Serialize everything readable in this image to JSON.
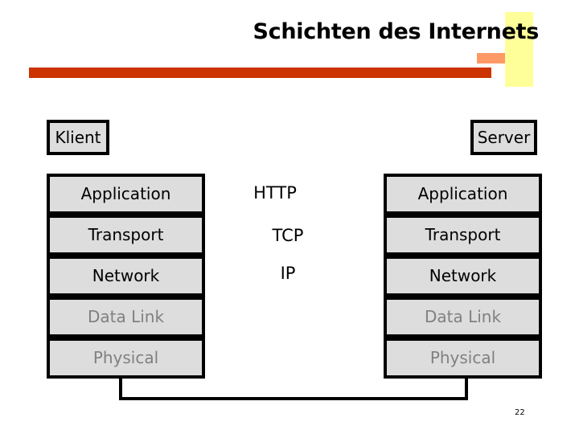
{
  "title": "Schichten des Internets",
  "client_label": "Klient",
  "server_label": "Server",
  "client_stack": [
    {
      "label": "Application",
      "dimmed": false
    },
    {
      "label": "Transport",
      "dimmed": false
    },
    {
      "label": "Network",
      "dimmed": false
    },
    {
      "label": "Data Link",
      "dimmed": true
    },
    {
      "label": "Physical",
      "dimmed": true
    }
  ],
  "server_stack": [
    {
      "label": "Application",
      "dimmed": false
    },
    {
      "label": "Transport",
      "dimmed": false
    },
    {
      "label": "Network",
      "dimmed": false
    },
    {
      "label": "Data Link",
      "dimmed": true
    },
    {
      "label": "Physical",
      "dimmed": true
    }
  ],
  "protocols": [
    "HTTP",
    "TCP",
    "IP"
  ],
  "page_number": "22",
  "colors": {
    "accent_red": "#cc3300",
    "accent_salmon": "#ff9966",
    "accent_yellow": "#ffff99",
    "box_fill": "#dddddd",
    "dim_text": "#808080"
  }
}
